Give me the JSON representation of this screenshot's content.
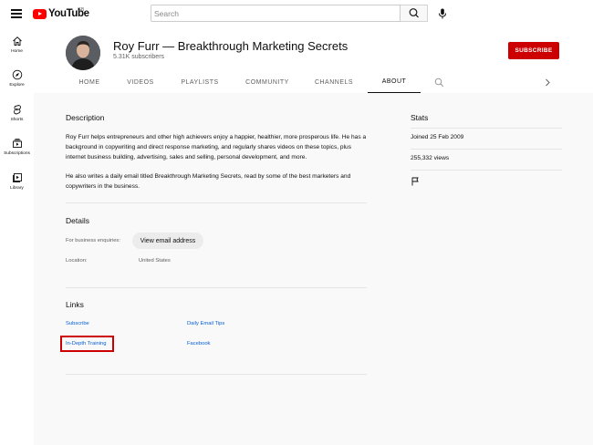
{
  "header": {
    "logo_text": "YouTube",
    "region": "GB",
    "search_placeholder": "Search"
  },
  "sidebar": {
    "items": [
      {
        "label": "Home",
        "icon": "home-icon"
      },
      {
        "label": "Explore",
        "icon": "compass-icon"
      },
      {
        "label": "Shorts",
        "icon": "shorts-icon"
      },
      {
        "label": "Subscriptions",
        "icon": "subscriptions-icon"
      },
      {
        "label": "Library",
        "icon": "library-icon"
      }
    ]
  },
  "channel": {
    "title": "Roy Furr — Breakthrough Marketing Secrets",
    "subscribers": "5.31K subscribers",
    "subscribe_label": "SUBSCRIBE"
  },
  "tabs": [
    "HOME",
    "VIDEOS",
    "PLAYLISTS",
    "COMMUNITY",
    "CHANNELS",
    "ABOUT"
  ],
  "about": {
    "description_title": "Description",
    "description_p1": "Roy Furr helps entrepreneurs and other high achievers enjoy a happier, healthier, more prosperous life. He has a background in copywriting and direct response marketing, and regularly shares videos on these topics, plus internet business building, advertising, sales and selling, personal development, and more.",
    "description_p2": "He also writes a daily email titled Breakthrough Marketing Secrets, read by some of the best marketers and copywriters in the business.",
    "details_title": "Details",
    "business_label": "For business enquiries:",
    "view_email_label": "View email address",
    "location_label": "Location:",
    "location_value": "United States",
    "links_title": "Links",
    "links": [
      "Subscribe",
      "Daily Email Tips",
      "In-Depth Training",
      "Facebook"
    ]
  },
  "stats": {
    "title": "Stats",
    "joined": "Joined 25 Feb 2009",
    "views": "255,332 views"
  },
  "colors": {
    "brand_red": "#ff0000",
    "subscribe_red": "#cc0000",
    "link_blue": "#065fd4",
    "content_bg": "#f9f9f9"
  }
}
